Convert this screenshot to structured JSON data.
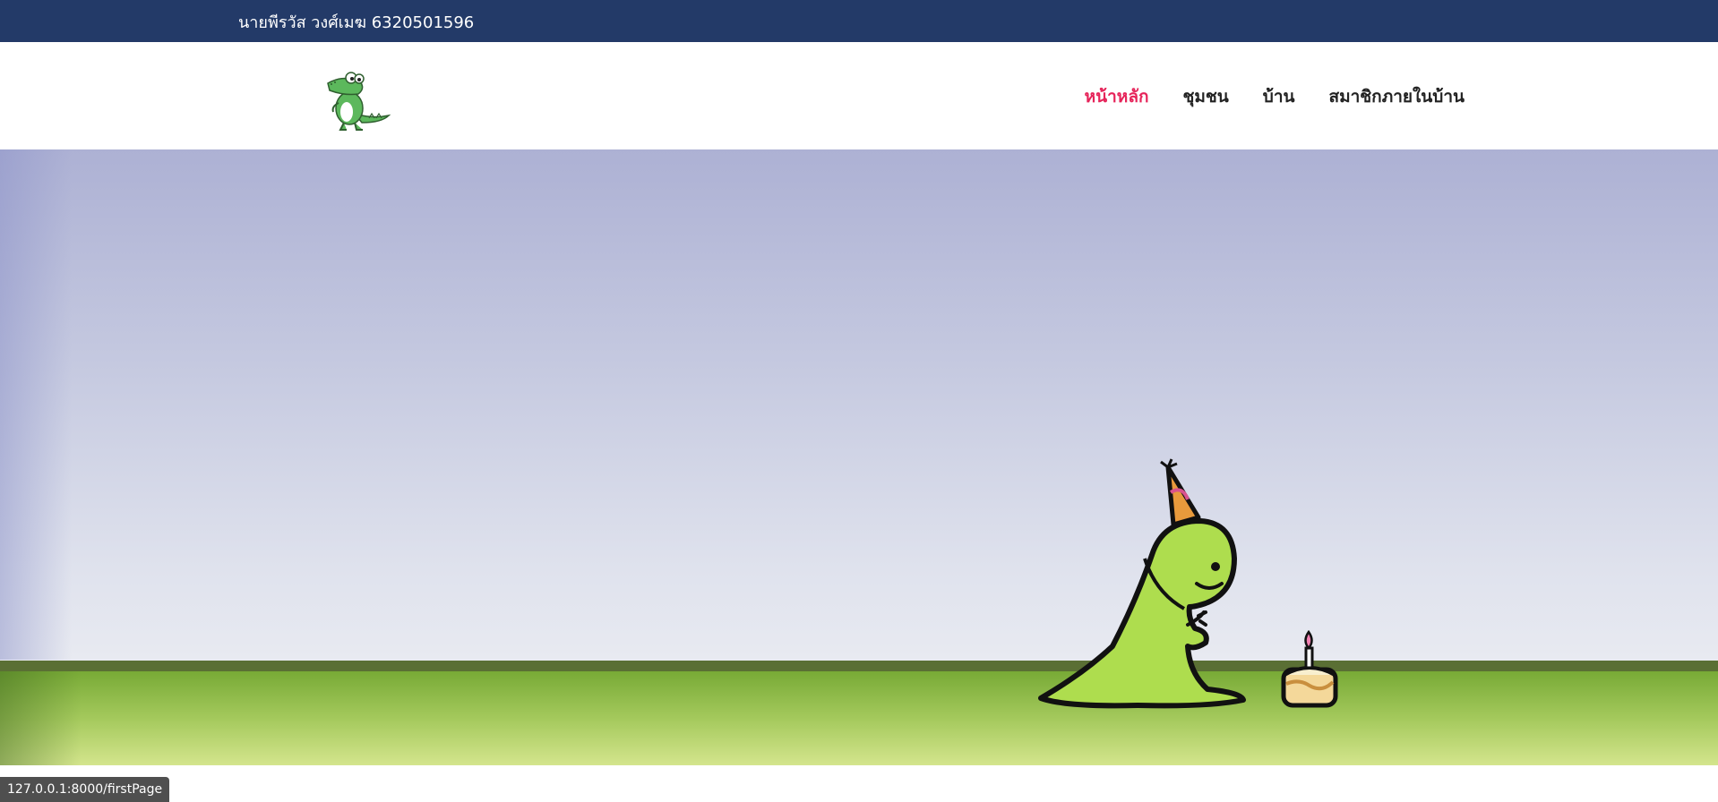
{
  "topbar": {
    "text": "นายพีรวัส วงศ์เมฆ 6320501596",
    "background": "#233a68"
  },
  "header": {
    "logo_icon": "crocodile-logo-icon",
    "nav": [
      {
        "label": "หน้าหลัก",
        "active": true
      },
      {
        "label": "ชุมชน",
        "active": false
      },
      {
        "label": "บ้าน",
        "active": false
      },
      {
        "label": "สมาชิกภายในบ้าน",
        "active": false
      }
    ],
    "active_color": "#e6245a"
  },
  "hero": {
    "illustration": "dinosaur-with-birthday-cake-illustration",
    "sky_color": "#c5c9e0",
    "grass_color": "#a4c95c"
  },
  "statusbar": {
    "url": "127.0.0.1:8000/firstPage"
  }
}
